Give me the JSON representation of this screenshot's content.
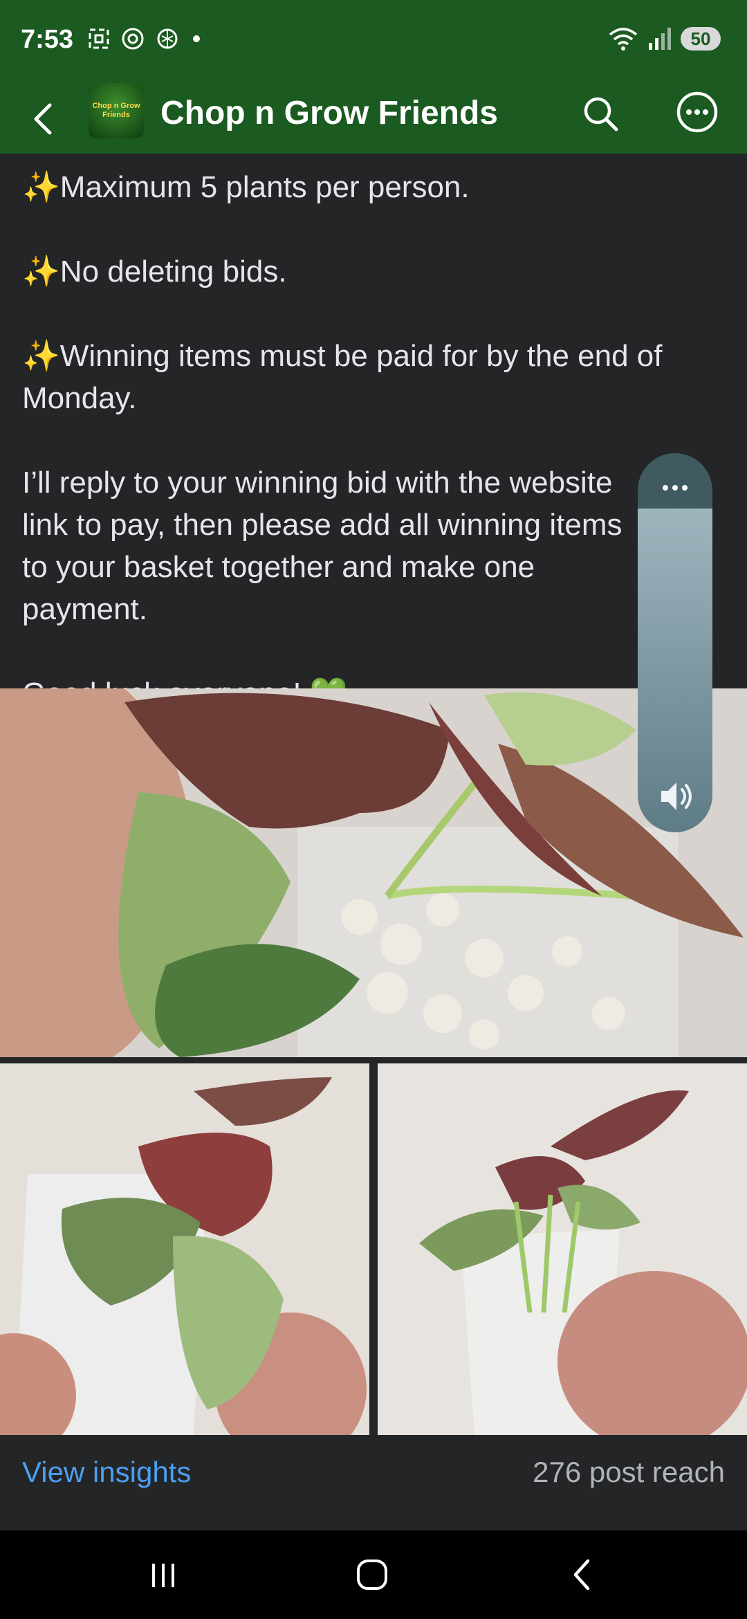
{
  "status_bar": {
    "time": "7:53",
    "battery": "50",
    "left_icons": [
      "screenshot-icon",
      "threads-icon",
      "chatgpt-icon",
      "dot-icon"
    ],
    "right_icons": [
      "wifi-icon",
      "signal-icon"
    ]
  },
  "header": {
    "title": "Chop n Grow Friends",
    "avatar_text": "Chop n Grow Friends"
  },
  "post": {
    "lines": [
      "Maximum 5 plants per person.",
      "No deleting bids.",
      "Winning items must be paid for by the end of Monday.",
      "I’ll reply to your winning bid with the website link to pay, then please add all winning items to your basket together and make one payment.",
      "Good luck everyone!"
    ],
    "sparkle": "✨",
    "heart": "💚"
  },
  "insights": {
    "link": "View insights",
    "reach": "276 post reach"
  },
  "colors": {
    "header_bg": "#1b5a20",
    "body_bg": "#242526",
    "link": "#4b9ff2"
  }
}
